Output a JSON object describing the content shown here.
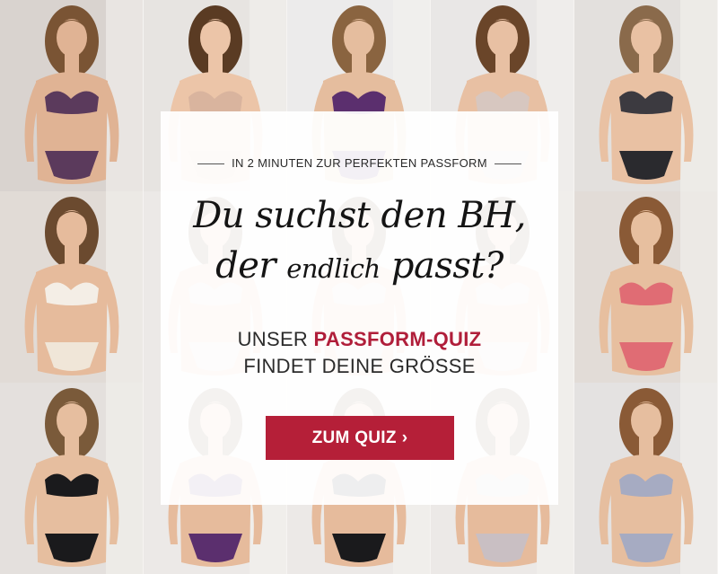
{
  "tiles": [
    {
      "bg": "#d9d3cf",
      "skin": "#e0b394",
      "hair": "#7a5434",
      "bra": "#5b3a5c",
      "panty": "#5b3a5c"
    },
    {
      "bg": "#e7e4e1",
      "skin": "#ecc5a8",
      "hair": "#5a3b23",
      "bra": "#d9b49e",
      "panty": "#d9b49e"
    },
    {
      "bg": "#ecebeb",
      "skin": "#e5bd9e",
      "hair": "#8a6440",
      "bra": "#5b2f6e",
      "panty": "#5b2f6e"
    },
    {
      "bg": "#e9e7e6",
      "skin": "#e8c0a3",
      "hair": "#6a4529",
      "bra": "#d7c7c0",
      "panty": "#d7c7c0"
    },
    {
      "bg": "#e3e0dd",
      "skin": "#e9c1a3",
      "hair": "#8a6a4b",
      "bra": "#3c3a40",
      "panty": "#2a2a2e"
    },
    {
      "bg": "#e1dbd6",
      "skin": "#e6bb9c",
      "hair": "#6b4a2f",
      "bra": "#f4eee6",
      "panty": "#f0e6d8"
    },
    {
      "bg": "#ece9e7",
      "skin": "#e6bb9c",
      "hair": "#6b4a2f",
      "bra": "#d8d3d0",
      "panty": "#d8d3d0"
    },
    {
      "bg": "#ece9e7",
      "skin": "#e6bb9c",
      "hair": "#6b4a2f",
      "bra": "#d8d3d0",
      "panty": "#d8d3d0"
    },
    {
      "bg": "#ece9e7",
      "skin": "#e6bb9c",
      "hair": "#6b4a2f",
      "bra": "#d8d3d0",
      "panty": "#d8d3d0"
    },
    {
      "bg": "#e2dcd7",
      "skin": "#e7bf9f",
      "hair": "#8a5a36",
      "bra": "#e06c74",
      "panty": "#e06c74"
    },
    {
      "bg": "#e4e0dd",
      "skin": "#e6be9f",
      "hair": "#7a5a3a",
      "bra": "#1a1a1c",
      "panty": "#1a1a1c"
    },
    {
      "bg": "#ece9e7",
      "skin": "#e6bb9c",
      "hair": "#6b4a2f",
      "bra": "#5b2f6e",
      "panty": "#5b2f6e"
    },
    {
      "bg": "#ece9e7",
      "skin": "#e6bb9c",
      "hair": "#6b4a2f",
      "bra": "#1a1a1c",
      "panty": "#1a1a1c"
    },
    {
      "bg": "#ece9e7",
      "skin": "#e6bb9c",
      "hair": "#6b4a2f",
      "bra": "#c9bfc3",
      "panty": "#c9bfc3"
    },
    {
      "bg": "#e4e2e1",
      "skin": "#e6be9f",
      "hair": "#8a5a36",
      "bra": "#a6abc2",
      "panty": "#a6abc2"
    }
  ],
  "panel": {
    "eyebrow": "IN 2 MINUTEN ZUR PERFEKTEN PASSFORM",
    "headline_line1": "Du suchst den BH,",
    "headline_line2_a": "der ",
    "headline_line2_b": "endlich",
    "headline_line2_c": " passt?",
    "sub_line1_plain": "UNSER ",
    "sub_line1_accent": "PASSFORM-QUIZ",
    "sub_line2": "FINDET DEINE GRÖSSE",
    "cta_label": "ZUM QUIZ",
    "cta_icon": "chevron-right-icon",
    "accent_color": "#b51f38"
  }
}
